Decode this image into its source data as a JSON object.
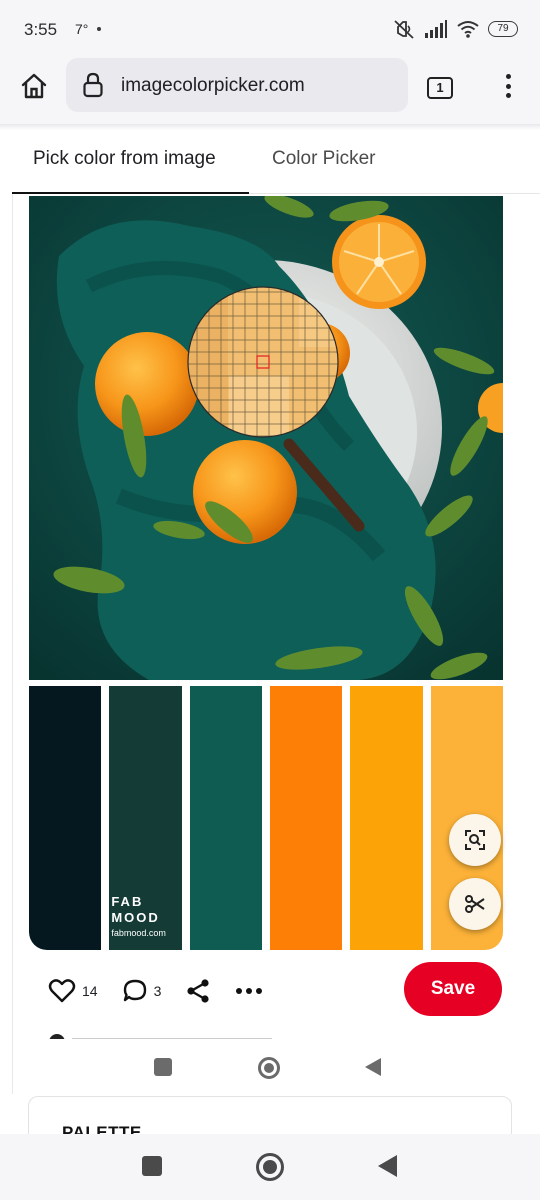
{
  "status_bar": {
    "time": "3:55",
    "temperature": "7°",
    "battery": "79",
    "icons": [
      "mute-icon",
      "signal-icon",
      "wifi-icon",
      "battery-icon"
    ]
  },
  "browser": {
    "url": "imagecolorpicker.com",
    "tab_count": "1",
    "icons": [
      "home-icon",
      "lock-icon",
      "tabs-icon",
      "more-vert-icon"
    ]
  },
  "page_tabs": {
    "active": "Pick color from image",
    "inactive": "Color Picker"
  },
  "image": {
    "description_icon": "oranges-on-teal-cloth-photo",
    "magnifier_icon": "pixel-magnifier-icon"
  },
  "palette": {
    "colors": [
      "#06181f",
      "#143b36",
      "#0e5c52",
      "#fd7f06",
      "#fca307",
      "#fcb238"
    ],
    "brand_line_1": "FAB",
    "brand_line_2": "MOOD",
    "brand_url": "fabmood.com"
  },
  "actions": {
    "likes": "14",
    "comments": "3",
    "save_label": "Save",
    "icons": [
      "heart-icon",
      "comment-icon",
      "share-icon",
      "more-horiz-icon",
      "visual-search-icon",
      "scissors-icon"
    ]
  },
  "palette_card": {
    "title": "PALETTE"
  },
  "accent": {
    "save_red": "#e60023"
  }
}
